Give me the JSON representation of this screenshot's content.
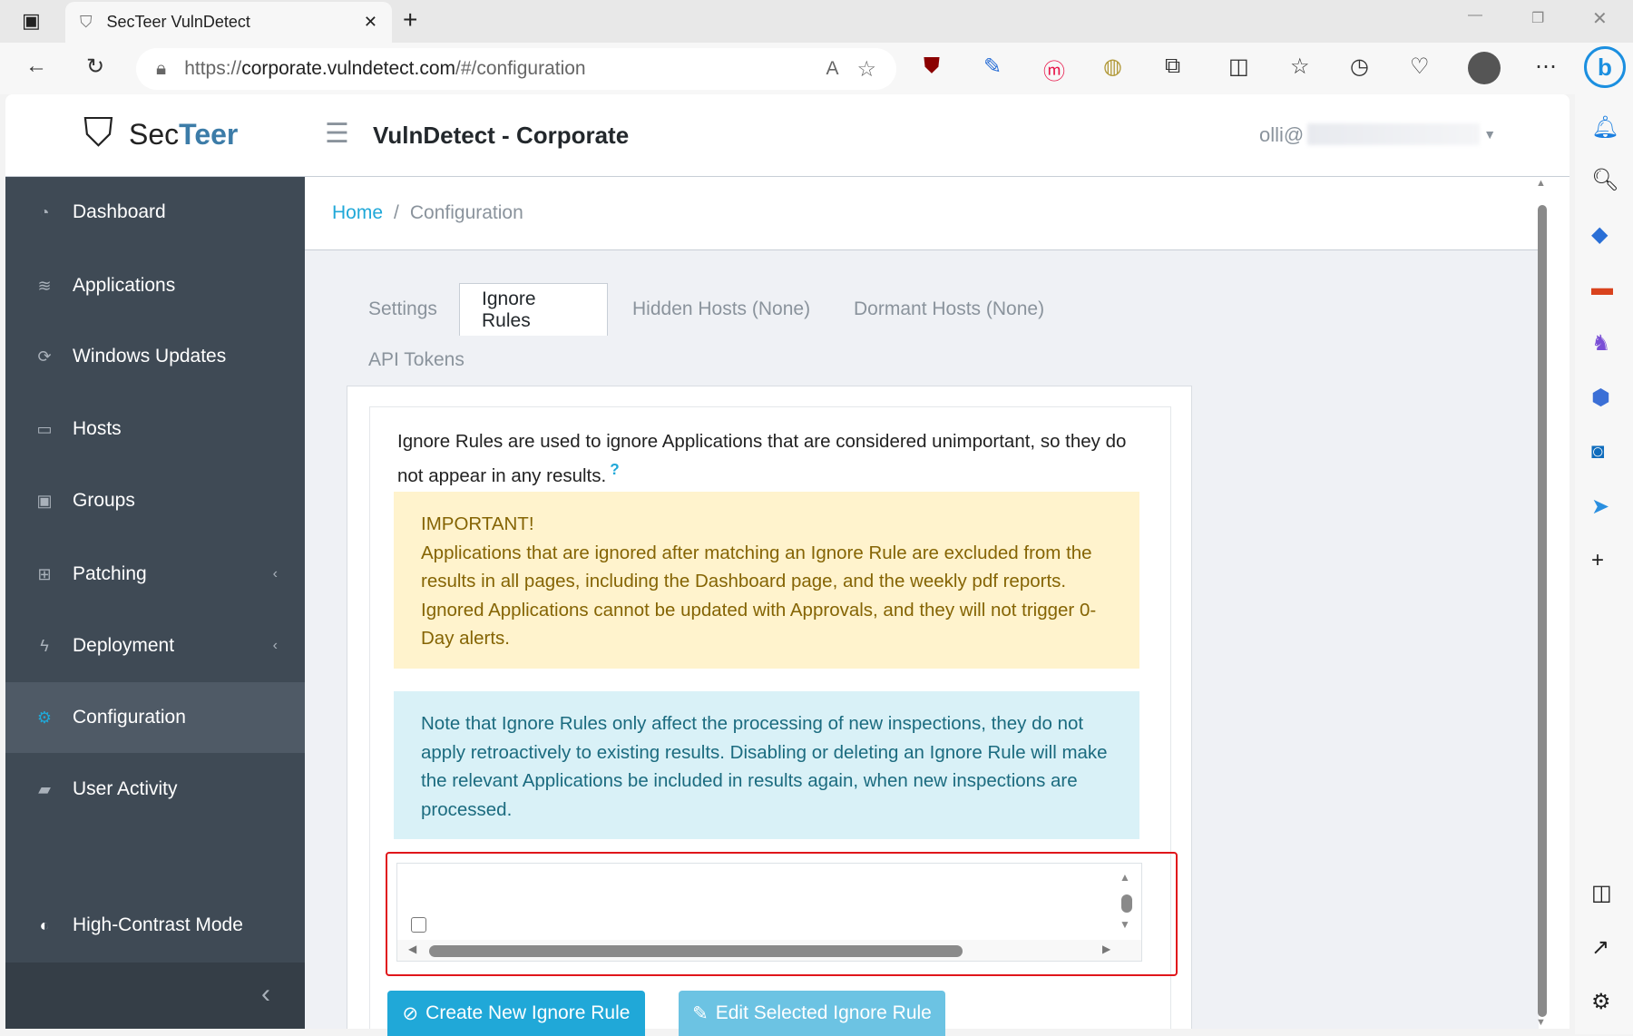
{
  "browser": {
    "tab_title": "SecTeer VulnDetect",
    "url_prefix": "https://",
    "url_host": "corporate.vulndetect.com",
    "url_path": "/#/configuration"
  },
  "header": {
    "logo_sec": "Sec",
    "logo_teer": "Teer",
    "title": "VulnDetect - Corporate",
    "user": "olli@"
  },
  "sidebar": {
    "items": [
      {
        "label": "Dashboard",
        "icon": "gauge-icon"
      },
      {
        "label": "Applications",
        "icon": "layers-icon"
      },
      {
        "label": "Windows Updates",
        "icon": "refresh-icon"
      },
      {
        "label": "Hosts",
        "icon": "monitor-icon"
      },
      {
        "label": "Groups",
        "icon": "group-icon"
      },
      {
        "label": "Patching",
        "icon": "plus-square-icon"
      },
      {
        "label": "Deployment",
        "icon": "bolt-icon"
      },
      {
        "label": "Configuration",
        "icon": "gear-icon"
      },
      {
        "label": "User Activity",
        "icon": "book-icon"
      }
    ],
    "high_contrast": "High-Contrast Mode"
  },
  "breadcrumb": {
    "home": "Home",
    "sep": "/",
    "current": "Configuration"
  },
  "tabs": [
    "Settings",
    "Ignore Rules",
    "Hidden Hosts (None)",
    "Dormant Hosts (None)",
    "API Tokens"
  ],
  "content": {
    "intro": "Ignore Rules are used to ignore Applications that are considered unimportant, so they do not appear in any results.",
    "help": "?",
    "warning_title": "IMPORTANT!",
    "warning_body": "Applications that are ignored after matching an Ignore Rule are excluded from the results in all pages, including the Dashboard page, and the weekly pdf reports. Ignored Applications cannot be updated with Approvals, and they will not trigger 0-Day alerts.",
    "info": "Note that Ignore Rules only affect the processing of new inspections, they do not apply retroactively to existing results. Disabling or deleting an Ignore Rule will make the relevant Applications be included in results again, when new inspections are processed."
  },
  "buttons": {
    "create": "Create New Ignore Rule",
    "edit": "Edit Selected Ignore Rule"
  },
  "colors": {
    "sidebar": "#3f4a55",
    "accent": "#20a8d8",
    "warning_bg": "#fff3cd",
    "info_bg": "#d9f1f7",
    "highlight": "#e0161b"
  }
}
